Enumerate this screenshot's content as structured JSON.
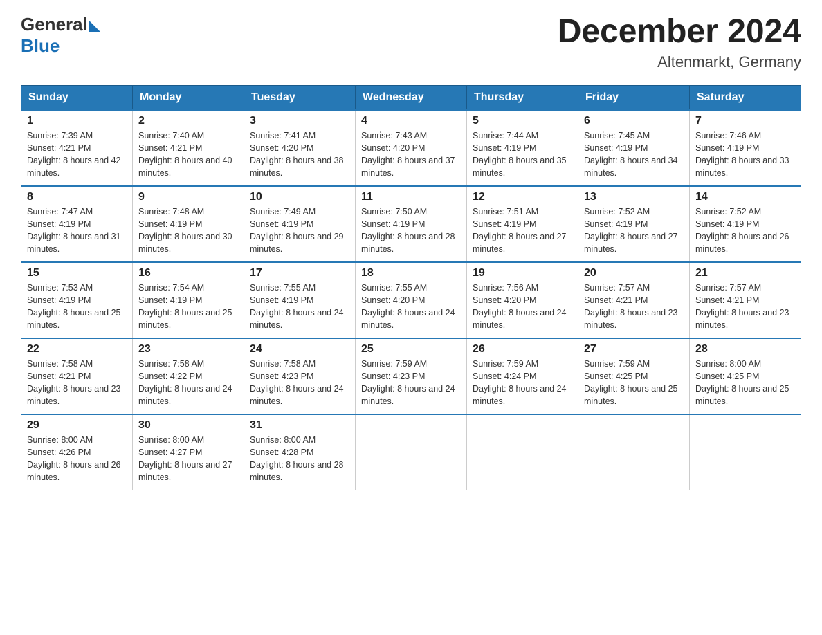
{
  "logo": {
    "general": "General",
    "blue": "Blue"
  },
  "title": "December 2024",
  "location": "Altenmarkt, Germany",
  "days_of_week": [
    "Sunday",
    "Monday",
    "Tuesday",
    "Wednesday",
    "Thursday",
    "Friday",
    "Saturday"
  ],
  "weeks": [
    [
      {
        "day": "1",
        "sunrise": "7:39 AM",
        "sunset": "4:21 PM",
        "daylight": "8 hours and 42 minutes."
      },
      {
        "day": "2",
        "sunrise": "7:40 AM",
        "sunset": "4:21 PM",
        "daylight": "8 hours and 40 minutes."
      },
      {
        "day": "3",
        "sunrise": "7:41 AM",
        "sunset": "4:20 PM",
        "daylight": "8 hours and 38 minutes."
      },
      {
        "day": "4",
        "sunrise": "7:43 AM",
        "sunset": "4:20 PM",
        "daylight": "8 hours and 37 minutes."
      },
      {
        "day": "5",
        "sunrise": "7:44 AM",
        "sunset": "4:19 PM",
        "daylight": "8 hours and 35 minutes."
      },
      {
        "day": "6",
        "sunrise": "7:45 AM",
        "sunset": "4:19 PM",
        "daylight": "8 hours and 34 minutes."
      },
      {
        "day": "7",
        "sunrise": "7:46 AM",
        "sunset": "4:19 PM",
        "daylight": "8 hours and 33 minutes."
      }
    ],
    [
      {
        "day": "8",
        "sunrise": "7:47 AM",
        "sunset": "4:19 PM",
        "daylight": "8 hours and 31 minutes."
      },
      {
        "day": "9",
        "sunrise": "7:48 AM",
        "sunset": "4:19 PM",
        "daylight": "8 hours and 30 minutes."
      },
      {
        "day": "10",
        "sunrise": "7:49 AM",
        "sunset": "4:19 PM",
        "daylight": "8 hours and 29 minutes."
      },
      {
        "day": "11",
        "sunrise": "7:50 AM",
        "sunset": "4:19 PM",
        "daylight": "8 hours and 28 minutes."
      },
      {
        "day": "12",
        "sunrise": "7:51 AM",
        "sunset": "4:19 PM",
        "daylight": "8 hours and 27 minutes."
      },
      {
        "day": "13",
        "sunrise": "7:52 AM",
        "sunset": "4:19 PM",
        "daylight": "8 hours and 27 minutes."
      },
      {
        "day": "14",
        "sunrise": "7:52 AM",
        "sunset": "4:19 PM",
        "daylight": "8 hours and 26 minutes."
      }
    ],
    [
      {
        "day": "15",
        "sunrise": "7:53 AM",
        "sunset": "4:19 PM",
        "daylight": "8 hours and 25 minutes."
      },
      {
        "day": "16",
        "sunrise": "7:54 AM",
        "sunset": "4:19 PM",
        "daylight": "8 hours and 25 minutes."
      },
      {
        "day": "17",
        "sunrise": "7:55 AM",
        "sunset": "4:19 PM",
        "daylight": "8 hours and 24 minutes."
      },
      {
        "day": "18",
        "sunrise": "7:55 AM",
        "sunset": "4:20 PM",
        "daylight": "8 hours and 24 minutes."
      },
      {
        "day": "19",
        "sunrise": "7:56 AM",
        "sunset": "4:20 PM",
        "daylight": "8 hours and 24 minutes."
      },
      {
        "day": "20",
        "sunrise": "7:57 AM",
        "sunset": "4:21 PM",
        "daylight": "8 hours and 23 minutes."
      },
      {
        "day": "21",
        "sunrise": "7:57 AM",
        "sunset": "4:21 PM",
        "daylight": "8 hours and 23 minutes."
      }
    ],
    [
      {
        "day": "22",
        "sunrise": "7:58 AM",
        "sunset": "4:21 PM",
        "daylight": "8 hours and 23 minutes."
      },
      {
        "day": "23",
        "sunrise": "7:58 AM",
        "sunset": "4:22 PM",
        "daylight": "8 hours and 24 minutes."
      },
      {
        "day": "24",
        "sunrise": "7:58 AM",
        "sunset": "4:23 PM",
        "daylight": "8 hours and 24 minutes."
      },
      {
        "day": "25",
        "sunrise": "7:59 AM",
        "sunset": "4:23 PM",
        "daylight": "8 hours and 24 minutes."
      },
      {
        "day": "26",
        "sunrise": "7:59 AM",
        "sunset": "4:24 PM",
        "daylight": "8 hours and 24 minutes."
      },
      {
        "day": "27",
        "sunrise": "7:59 AM",
        "sunset": "4:25 PM",
        "daylight": "8 hours and 25 minutes."
      },
      {
        "day": "28",
        "sunrise": "8:00 AM",
        "sunset": "4:25 PM",
        "daylight": "8 hours and 25 minutes."
      }
    ],
    [
      {
        "day": "29",
        "sunrise": "8:00 AM",
        "sunset": "4:26 PM",
        "daylight": "8 hours and 26 minutes."
      },
      {
        "day": "30",
        "sunrise": "8:00 AM",
        "sunset": "4:27 PM",
        "daylight": "8 hours and 27 minutes."
      },
      {
        "day": "31",
        "sunrise": "8:00 AM",
        "sunset": "4:28 PM",
        "daylight": "8 hours and 28 minutes."
      },
      null,
      null,
      null,
      null
    ]
  ]
}
